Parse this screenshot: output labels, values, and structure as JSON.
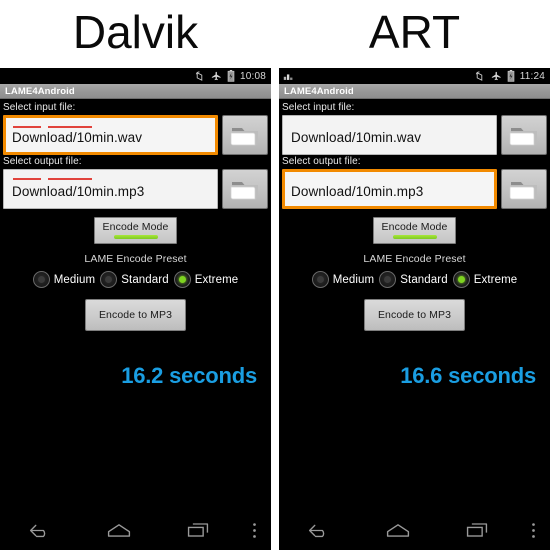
{
  "panels": [
    {
      "heading": "Dalvik",
      "statusbar": {
        "notification_icon": "",
        "icons": [
          "rotate-icon",
          "airplane-mode-icon",
          "battery-icon"
        ],
        "time": "10:08"
      },
      "app_title": "LAME4Android",
      "input_label": "Select input file:",
      "input_value": "Download/10min.wav",
      "input_focused": true,
      "input_spellcheck": true,
      "output_label": "Select output file:",
      "output_value": "Download/10min.mp3",
      "output_focused": false,
      "output_spellcheck": true,
      "browse_icon": "folder-icon",
      "tab_label": "Encode Mode",
      "preset_label": "LAME Encode Preset",
      "presets": [
        {
          "label": "Medium",
          "selected": false
        },
        {
          "label": "Standard",
          "selected": false
        },
        {
          "label": "Extreme",
          "selected": true
        }
      ],
      "encode_button": "Encode to MP3",
      "result": "16.2 seconds",
      "nav": [
        "back-icon",
        "home-icon",
        "recents-icon",
        "overflow-menu-icon"
      ]
    },
    {
      "heading": "ART",
      "statusbar": {
        "notification_icon": "notification-icon",
        "icons": [
          "rotate-icon",
          "airplane-mode-icon",
          "battery-icon"
        ],
        "time": "11:24"
      },
      "app_title": "LAME4Android",
      "input_label": "Select input file:",
      "input_value": "Download/10min.wav",
      "input_focused": false,
      "input_spellcheck": false,
      "output_label": "Select output file:",
      "output_value": "Download/10min.mp3",
      "output_focused": true,
      "output_spellcheck": false,
      "browse_icon": "folder-icon",
      "tab_label": "Encode Mode",
      "preset_label": "LAME Encode Preset",
      "presets": [
        {
          "label": "Medium",
          "selected": false
        },
        {
          "label": "Standard",
          "selected": false
        },
        {
          "label": "Extreme",
          "selected": true
        }
      ],
      "encode_button": "Encode to MP3",
      "result": "16.6 seconds",
      "nav": [
        "back-icon",
        "home-icon",
        "recents-icon",
        "overflow-menu-icon"
      ]
    }
  ],
  "colors": {
    "result_blue": "#1a9ee2",
    "focus_orange": "#f28a00",
    "preset_green": "#7ed321",
    "spellcheck_red": "#e1433c",
    "screen_black": "#000000"
  }
}
